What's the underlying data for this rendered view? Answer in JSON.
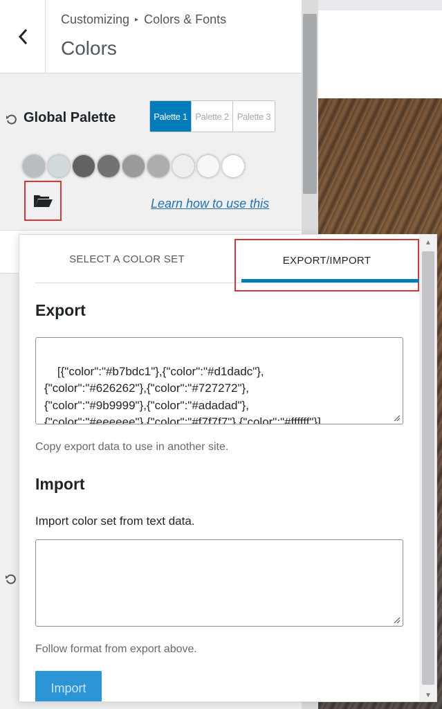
{
  "header": {
    "breadcrumb_root": "Customizing",
    "breadcrumb_child": "Colors & Fonts",
    "title": "Colors",
    "back_icon": "chevron-left-icon"
  },
  "palette": {
    "label": "Global Palette",
    "reset_icon": "undo-icon",
    "tabs": [
      "Palette 1",
      "Palette 2",
      "Palette 3"
    ],
    "active_tab": "Palette 1",
    "swatches": [
      "#b7bdc1",
      "#d1dadc",
      "#626262",
      "#727272",
      "#9b9999",
      "#adadad",
      "#eeeeee",
      "#f7f7f7",
      "#ffffff"
    ],
    "folder_icon": "folder-open-icon",
    "learn_link": "Learn how to use this"
  },
  "popover": {
    "tab_select": "SELECT A COLOR SET",
    "tab_export": "EXPORT/IMPORT",
    "export_title": "Export",
    "export_data": "[{\"color\":\"#b7bdc1\"},{\"color\":\"#d1dadc\"},\n{\"color\":\"#626262\"},{\"color\":\"#727272\"},\n{\"color\":\"#9b9999\"},{\"color\":\"#adadad\"},\n{\"color\":\"#eeeeee\"},{\"color\":\"#f7f7f7\"},{\"color\":\"#ffffff\"}]",
    "export_help": "Copy export data to use in another site.",
    "import_title": "Import",
    "import_desc": "Import color set from text data.",
    "import_value": "",
    "import_help": "Follow format from export above.",
    "import_button": "Import"
  },
  "colors": {
    "accent": "#007cba",
    "highlight_border": "#d63638",
    "link": "#2271b1"
  }
}
